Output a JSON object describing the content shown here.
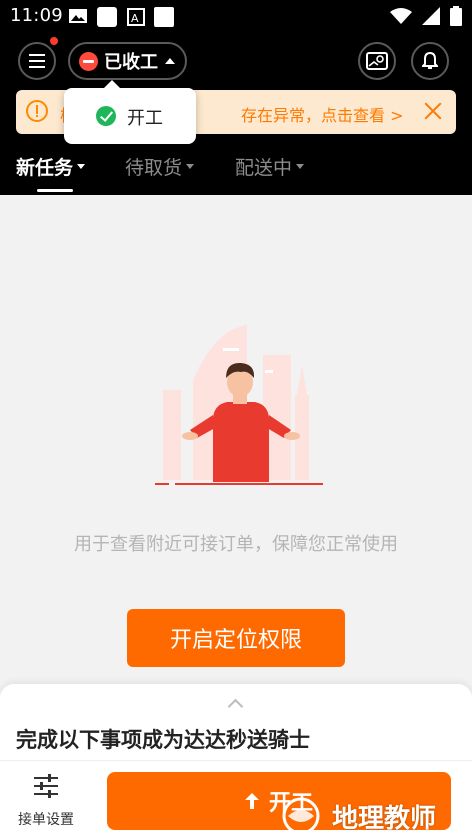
{
  "status_bar": {
    "time": "11:09"
  },
  "header": {
    "status_label": "已收工",
    "has_notification_dot": true
  },
  "notice": {
    "lead_char": "核",
    "text": "存在异常，点击查看 >",
    "color": "#ff7a00"
  },
  "popup": {
    "label": "开工"
  },
  "tabs": [
    {
      "label": "新任务",
      "active": true
    },
    {
      "label": "待取货",
      "active": false
    },
    {
      "label": "配送中",
      "active": false
    }
  ],
  "empty_state": {
    "message": "用于查看附近可接订单，保障您正常使用",
    "button_label": "开启定位权限"
  },
  "sheet": {
    "title": "完成以下事项成为达达秒送骑士"
  },
  "bottom_bar": {
    "settings_label": "接单设置",
    "start_label": "开工"
  },
  "watermark": {
    "text": "地理教师"
  },
  "colors": {
    "accent": "#ff6a00",
    "header_bg": "#000000",
    "notice_bg": "#fde9cf",
    "success": "#1fb65a",
    "danger": "#ff4b3e"
  }
}
